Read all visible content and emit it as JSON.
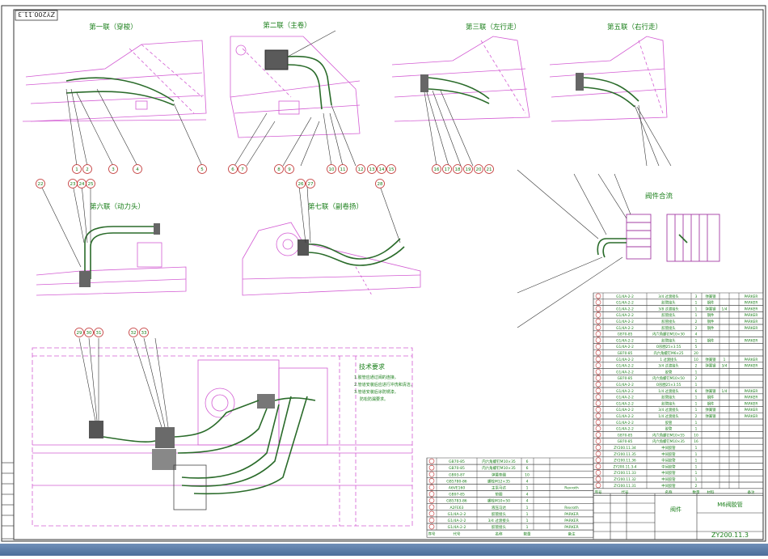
{
  "drawing": {
    "corner_code": "ZY200.11.3",
    "views": [
      {
        "title": "第一联（穿梭）"
      },
      {
        "title": "第二联（主卷）"
      },
      {
        "title": "第三联（左行走）"
      },
      {
        "title": "第五联（右行走）"
      },
      {
        "title": "第六联（动力头）"
      },
      {
        "title": "第七联（副卷扬）"
      },
      {
        "title": "阀件合流"
      }
    ],
    "tech_req": {
      "title": "技术要求",
      "lines": [
        "1.胶管应通过阀的连接。",
        "2.管道安装后应进行冲洗和清洁。",
        "3.管道安装后涂防锈漆。",
        "防松防漏要求。"
      ]
    },
    "title_block": {
      "part_name": "阀件",
      "drawing_name": "M6阀胶管",
      "code": "ZY200.11.3"
    }
  },
  "balloons": [
    "1",
    "2",
    "3",
    "4",
    "5",
    "6",
    "7",
    "8",
    "9",
    "10",
    "11",
    "12",
    "13",
    "14",
    "15",
    "16",
    "17",
    "18",
    "19",
    "20",
    "21",
    "22",
    "23",
    "24",
    "25",
    "26",
    "27",
    "28",
    "29",
    "30",
    "31",
    "32",
    "33"
  ],
  "bom_right": [
    {
      "no": "38",
      "code": "G1/4A-2-2",
      "name": "3/4 过渡接头",
      "qty": "3",
      "mat": "弹簧钢",
      "c6": "",
      "supplier": "PARKER"
    },
    {
      "no": "37",
      "code": "G1/4A-2-2",
      "name": "胶管接头",
      "qty": "1",
      "mat": "钢件",
      "c6": "",
      "supplier": "PARKER"
    },
    {
      "no": "36",
      "code": "G1/4A-2-2",
      "name": "3/8 过渡接头",
      "qty": "1",
      "mat": "弹簧钢",
      "c6": "1/4",
      "supplier": "PARKER"
    },
    {
      "no": "35",
      "code": "G1/4A-2-2",
      "name": "胶管接头",
      "qty": "1",
      "mat": "钢件",
      "c6": "",
      "supplier": "PARKER"
    },
    {
      "no": "34",
      "code": "G1/4A-2-2",
      "name": "胶管接头",
      "qty": "2",
      "mat": "钢件",
      "c6": "",
      "supplier": "PARKER"
    },
    {
      "no": "33",
      "code": "G1/4A-2-2",
      "name": "胶管接头",
      "qty": "2",
      "mat": "钢件",
      "c6": "",
      "supplier": "PARKER"
    },
    {
      "no": "32",
      "code": "GB70-85",
      "name": "内六角螺钉M10×30",
      "qty": "4",
      "mat": "",
      "c6": "",
      "supplier": ""
    },
    {
      "no": "31",
      "code": "G1/4A-2-2",
      "name": "胶管接头",
      "qty": "1",
      "mat": "钢件",
      "c6": "",
      "supplier": "PARKER"
    },
    {
      "no": "30",
      "code": "G1/4A-2-2",
      "name": "O形圈25×3.55",
      "qty": "5",
      "mat": "",
      "c6": "",
      "supplier": ""
    },
    {
      "no": "29",
      "code": "GB70-85",
      "name": "内六角螺钉M6×25",
      "qty": "20",
      "mat": "",
      "c6": "",
      "supplier": ""
    },
    {
      "no": "28",
      "code": "G1/4A-2-2",
      "name": "1 过渡接头",
      "qty": "10",
      "mat": "弹簧钢",
      "c6": "1",
      "supplier": "PARKER"
    },
    {
      "no": "27",
      "code": "G1/4A-2-2",
      "name": "3/4 过渡接头",
      "qty": "2",
      "mat": "弹簧钢",
      "c6": "3/4",
      "supplier": "PARKER"
    },
    {
      "no": "26",
      "code": "G1/4A-2-2",
      "name": "胶管",
      "qty": "1",
      "mat": "",
      "c6": "",
      "supplier": ""
    },
    {
      "no": "25",
      "code": "GB70-85",
      "name": "内六角螺钉M10×50",
      "qty": "2",
      "mat": "",
      "c6": "",
      "supplier": ""
    },
    {
      "no": "24",
      "code": "G1/4A-2-2",
      "name": "O形圈25×3.55",
      "qty": "1",
      "mat": "",
      "c6": "",
      "supplier": ""
    },
    {
      "no": "23",
      "code": "G1/4A-2-2",
      "name": "1/4 过渡接头",
      "qty": "6",
      "mat": "弹簧钢",
      "c6": "1/4",
      "supplier": "PARKER"
    },
    {
      "no": "22",
      "code": "G1/4A-2-2",
      "name": "胶管接头",
      "qty": "1",
      "mat": "钢件",
      "c6": "",
      "supplier": "PARKER"
    },
    {
      "no": "21",
      "code": "G1/4A-2-2",
      "name": "胶管接头",
      "qty": "1",
      "mat": "钢件",
      "c6": "",
      "supplier": "PARKER"
    },
    {
      "no": "20",
      "code": "G1/4A-2-2",
      "name": "3/4 过渡接头",
      "qty": "1",
      "mat": "弹簧钢",
      "c6": "",
      "supplier": "PARKER"
    },
    {
      "no": "19",
      "code": "G1/4A-2-2",
      "name": "1/4 过渡接头",
      "qty": "2",
      "mat": "弹簧钢",
      "c6": "",
      "supplier": "PARKER"
    },
    {
      "no": "18",
      "code": "G1/4A-2-2",
      "name": "胶管",
      "qty": "1",
      "mat": "",
      "c6": "",
      "supplier": ""
    },
    {
      "no": "17",
      "code": "G1/4A-2-2",
      "name": "胶管",
      "qty": "1",
      "mat": "",
      "c6": "",
      "supplier": ""
    },
    {
      "no": "16",
      "code": "GB70-85",
      "name": "内六角螺钉M10×55",
      "qty": "10",
      "mat": "",
      "c6": "",
      "supplier": ""
    },
    {
      "no": "15",
      "code": "GB70-85",
      "name": "内六角螺钉M10×35",
      "qty": "16",
      "mat": "",
      "c6": "",
      "supplier": ""
    },
    {
      "no": "14",
      "code": "ZY200.11.34",
      "name": "中间胶管",
      "qty": "1",
      "mat": "",
      "c6": "",
      "supplier": ""
    },
    {
      "no": "13",
      "code": "ZY200.11.35",
      "name": "中间胶管",
      "qty": "1",
      "mat": "",
      "c6": "",
      "supplier": ""
    },
    {
      "no": "12",
      "code": "ZY200.11.36",
      "name": "中间胶管",
      "qty": "1",
      "mat": "",
      "c6": "",
      "supplier": ""
    },
    {
      "no": "11",
      "code": "ZY200.11.3-4",
      "name": "中间胶管",
      "qty": "1",
      "mat": "",
      "c6": "",
      "supplier": ""
    },
    {
      "no": "10",
      "code": "ZY200.11.33",
      "name": "中间胶管",
      "qty": "1",
      "mat": "",
      "c6": "",
      "supplier": ""
    },
    {
      "no": "9",
      "code": "ZY200.11.32",
      "name": "中间胶管",
      "qty": "1",
      "mat": "",
      "c6": "",
      "supplier": ""
    },
    {
      "no": "8",
      "code": "ZY200.11.31",
      "name": "中间胶管",
      "qty": "2",
      "mat": "",
      "c6": "",
      "supplier": ""
    }
  ],
  "bom_right_header": {
    "no": "序号",
    "code": "代号",
    "name": "名称",
    "qty": "数量",
    "mat": "材料",
    "supplier": "备注"
  },
  "bom_left": [
    {
      "no": "7",
      "code": "GB70-85",
      "name": "内六角螺钉M10×35",
      "qty": "6",
      "supplier": ""
    },
    {
      "no": "6",
      "code": "GB70-85",
      "name": "内六角螺钉M10×35",
      "qty": "6",
      "supplier": ""
    },
    {
      "no": "5",
      "code": "GB93-87",
      "name": "弹簧垫圈",
      "qty": "10",
      "supplier": ""
    },
    {
      "no": "4",
      "code": "GB5780-86",
      "name": "螺栓M12×35",
      "qty": "4",
      "supplier": ""
    },
    {
      "no": "3",
      "code": "A6VE160",
      "name": "主泵马达",
      "qty": "1",
      "supplier": "Rexroth"
    },
    {
      "no": "2",
      "code": "GB97-85",
      "name": "垫圈",
      "qty": "4",
      "supplier": ""
    },
    {
      "no": "1",
      "code": "GB5783-86",
      "name": "螺栓M10×50",
      "qty": "4",
      "supplier": ""
    },
    {
      "no": "",
      "code": "A2FE63",
      "name": "液压马达",
      "qty": "1",
      "supplier": "Rexroth"
    },
    {
      "no": "",
      "code": "G1/4A-2-2",
      "name": "胶管接头",
      "qty": "1",
      "supplier": "PARKER"
    },
    {
      "no": "",
      "code": "G1/4A-2-2",
      "name": "3/4 过渡接头",
      "qty": "1",
      "supplier": "PARKER"
    },
    {
      "no": "",
      "code": "G1/4A-2-2",
      "name": "胶管接头",
      "qty": "1",
      "supplier": "PARKER"
    }
  ],
  "bom_left_header": {
    "no": "序号",
    "code": "代号",
    "name": "名称",
    "qty": "数量",
    "supplier": "备注"
  }
}
